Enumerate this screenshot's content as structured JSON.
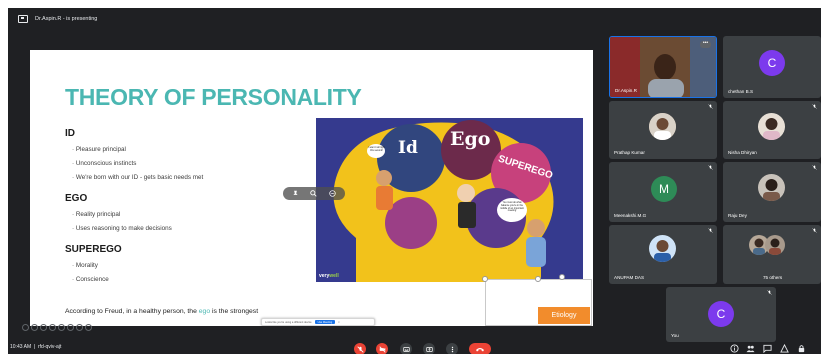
{
  "meeting": {
    "presenter_text": "Dr.Aspin.R - is presenting",
    "time": "10:43 AM",
    "meeting_code": "rfd-qviv-ajt"
  },
  "slide": {
    "title": "THEORY OF PERSONALITY",
    "sections": [
      {
        "heading": "ID",
        "points": [
          "Pleasure principal",
          "Unconscious instincts",
          "We're born with our ID - gets basic needs met"
        ]
      },
      {
        "heading": "EGO",
        "points": [
          "Reality principal",
          "Uses reasoning to make decisions"
        ]
      },
      {
        "heading": "SUPEREGO",
        "points": [
          "Morality",
          "Conscience"
        ]
      }
    ],
    "bubble_labels": {
      "id": "Id",
      "ego": "Ego",
      "superego": "SUPEREGO"
    },
    "speech_bubbles": [
      "I want it all right this second!",
      "You must do what balance you're in the middle of an important meeting"
    ],
    "footer_prefix": "According to Freud, in a healthy person, the",
    "footer_highlight": "ego",
    "footer_suffix": "is the strongest",
    "etiology_button": "Etiology",
    "logo_left": "very",
    "logo_right": "well",
    "popup": {
      "text": "Looks like you're using a different device",
      "button": "Use Meeting",
      "close": "×"
    }
  },
  "participants": [
    {
      "name": "Dr.Aspin.R",
      "type": "video"
    },
    {
      "name": "chethan B.S",
      "type": "letter",
      "letter": "C",
      "color": "#7c3aed"
    },
    {
      "name": "Prathap Kumar",
      "type": "photo"
    },
    {
      "name": "Nisha Dhiryan",
      "type": "photo"
    },
    {
      "name": "Meenakshi.M.G",
      "type": "letter",
      "letter": "M",
      "color": "#2e8b57"
    },
    {
      "name": "Raju Dey",
      "type": "photo"
    },
    {
      "name": "ANUPAM DAS",
      "type": "photo"
    },
    {
      "name": "75 others",
      "type": "group"
    },
    {
      "name": "You",
      "type": "letter",
      "letter": "C",
      "color": "#7c3aed"
    }
  ],
  "colors": {
    "background": "#1f2023",
    "tile": "#3c4043",
    "accent_teal": "#4bb7b2",
    "red": "#ea4335",
    "orange": "#f28c2c",
    "brain_yellow": "#f2c21b",
    "art_background": "#353a8e"
  },
  "icons": [
    "present-screen-icon",
    "mic-off-icon",
    "camera-off-icon",
    "captions-icon",
    "present-now-icon",
    "more-options-icon",
    "end-call-icon",
    "info-icon",
    "people-icon",
    "chat-icon",
    "activities-icon",
    "lock-icon"
  ]
}
